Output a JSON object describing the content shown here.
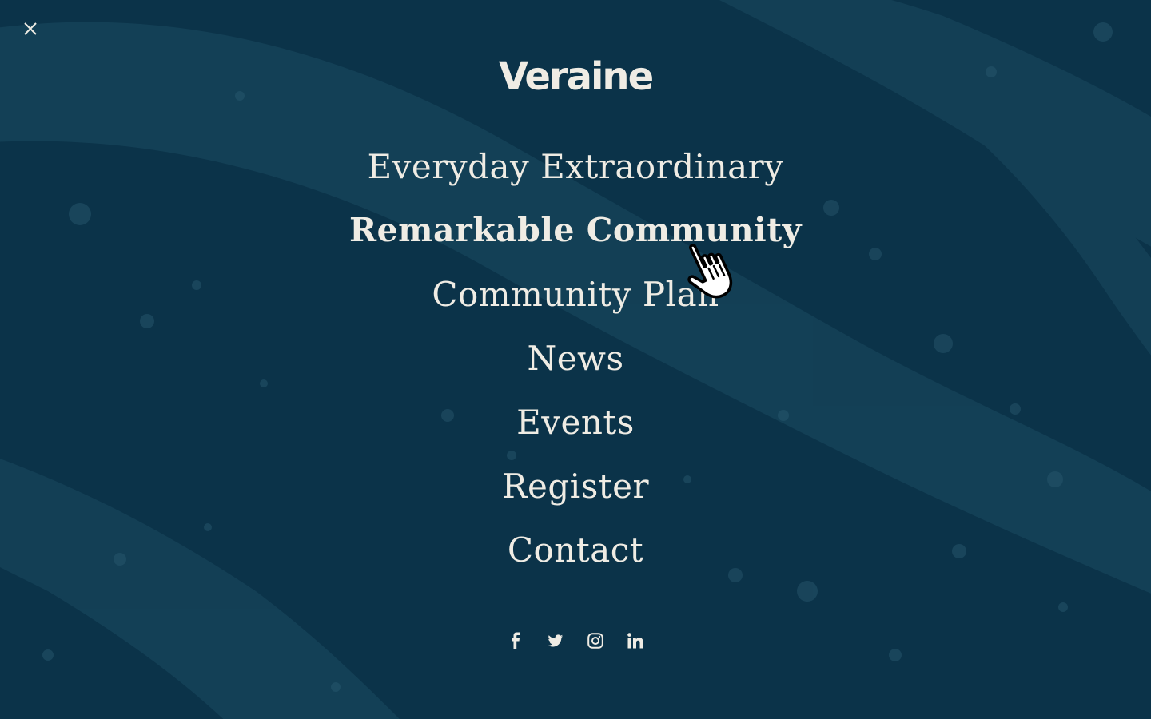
{
  "brand": {
    "logo_text": "Veraine"
  },
  "colors": {
    "background": "#0b3349",
    "text": "#efece4",
    "texture": "#1b4a60"
  },
  "close_icon": "close-icon",
  "menu": {
    "items": [
      {
        "label": "Everyday Extraordinary",
        "active": false
      },
      {
        "label": "Remarkable Community",
        "active": true
      },
      {
        "label": "Community Plan",
        "active": false
      },
      {
        "label": "News",
        "active": false
      },
      {
        "label": "Events",
        "active": false
      },
      {
        "label": "Register",
        "active": false
      },
      {
        "label": "Contact",
        "active": false
      }
    ]
  },
  "social": {
    "items": [
      {
        "icon": "facebook-icon"
      },
      {
        "icon": "twitter-icon"
      },
      {
        "icon": "instagram-icon"
      },
      {
        "icon": "linkedin-icon"
      }
    ]
  },
  "cursor": {
    "type": "pointer-hand-icon"
  }
}
